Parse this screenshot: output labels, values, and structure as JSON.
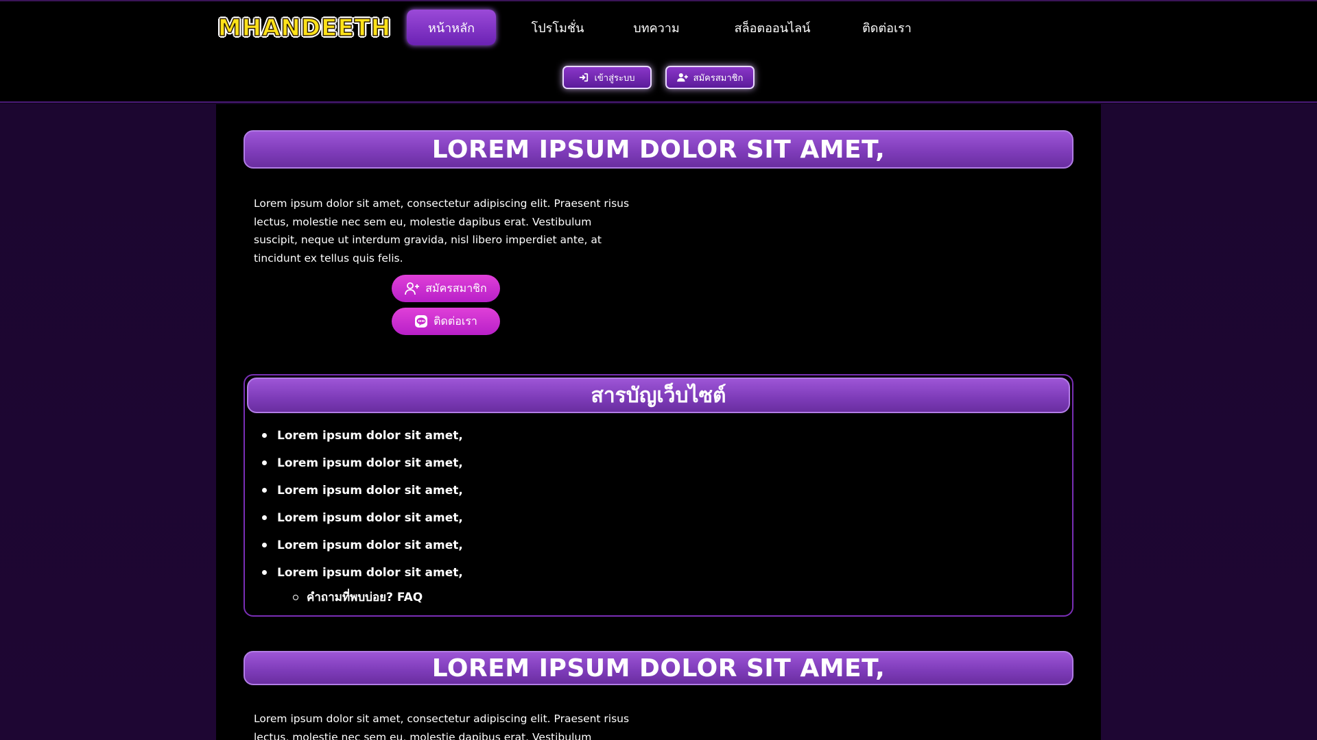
{
  "brand": {
    "logo_text": "MHANDEETH",
    "accent": "#7d3bb8",
    "pill_color": "#d030d0",
    "logo_color": "#ffe21a"
  },
  "nav": {
    "items": [
      {
        "label": "หน้าหลัก",
        "active": true
      },
      {
        "label": "โปรโมชั่น",
        "active": false
      },
      {
        "label": "บทความ",
        "active": false
      },
      {
        "label": "สล็อตออนไลน์",
        "active": false
      },
      {
        "label": "ติดต่อเรา",
        "active": false
      }
    ]
  },
  "auth": {
    "login_label": "เข้าสู่ระบบ",
    "register_label": "สมัครสมาชิก"
  },
  "section1": {
    "title": "LOREM IPSUM DOLOR SIT AMET,",
    "paragraph": "Lorem ipsum dolor sit amet, consectetur adipiscing elit. Praesent risus lectus, molestie nec sem eu, molestie dapibus erat. Vestibulum suscipit, neque ut interdum gravida, nisl libero imperdiet ante, at tincidunt ex tellus quis felis.",
    "register_button": "สมัครสมาชิก",
    "contact_button": "ติดต่อเรา"
  },
  "toc": {
    "title": "สารบัญเว็บไซต์",
    "items": [
      "Lorem ipsum dolor sit amet,",
      "Lorem ipsum dolor sit amet,",
      "Lorem ipsum dolor sit amet,",
      "Lorem ipsum dolor sit amet,",
      "Lorem ipsum dolor sit amet,",
      "Lorem ipsum dolor sit amet,"
    ],
    "sub_item": "คำถามที่พบบ่อย? FAQ"
  },
  "section2": {
    "title": "LOREM IPSUM DOLOR SIT AMET,",
    "paragraph": "Lorem ipsum dolor sit amet, consectetur adipiscing elit. Praesent risus lectus, molestie nec sem eu, molestie dapibus erat. Vestibulum suscipit, neque ut"
  }
}
